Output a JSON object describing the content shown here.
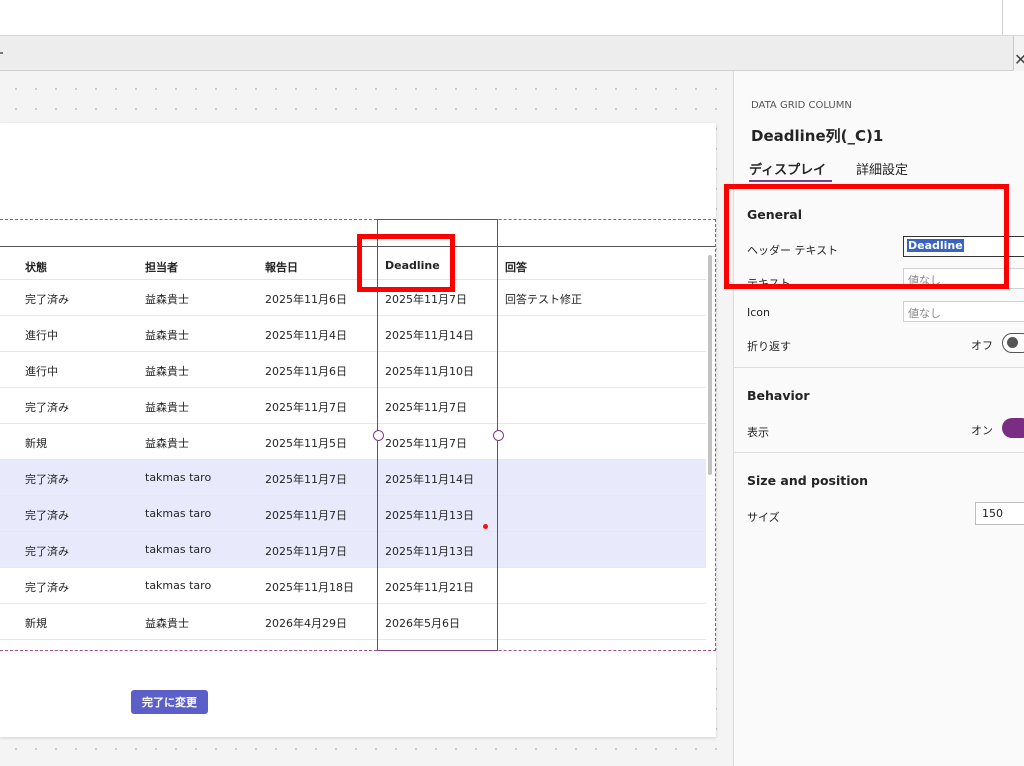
{
  "grid": {
    "headers": [
      "状態",
      "担当者",
      "報告日",
      "Deadline",
      "回答"
    ],
    "rows": [
      {
        "status": "完了済み",
        "owner": "益森貴士",
        "reported": "2025年11月6日",
        "deadline": "2025年11月7日",
        "answer": "回答テスト修正",
        "selected": false
      },
      {
        "status": "進行中",
        "owner": "益森貴士",
        "reported": "2025年11月4日",
        "deadline": "2025年11月14日",
        "answer": "",
        "selected": false
      },
      {
        "status": "進行中",
        "owner": "益森貴士",
        "reported": "2025年11月6日",
        "deadline": "2025年11月10日",
        "answer": "",
        "selected": false
      },
      {
        "status": "完了済み",
        "owner": "益森貴士",
        "reported": "2025年11月7日",
        "deadline": "2025年11月7日",
        "answer": "",
        "selected": false
      },
      {
        "status": "新規",
        "owner": "益森貴士",
        "reported": "2025年11月5日",
        "deadline": "2025年11月7日",
        "answer": "",
        "selected": false
      },
      {
        "status": "完了済み",
        "owner": "takmas taro",
        "reported": "2025年11月7日",
        "deadline": "2025年11月14日",
        "answer": "",
        "selected": true
      },
      {
        "status": "完了済み",
        "owner": "takmas taro",
        "reported": "2025年11月7日",
        "deadline": "2025年11月13日",
        "answer": "",
        "selected": true
      },
      {
        "status": "完了済み",
        "owner": "takmas taro",
        "reported": "2025年11月7日",
        "deadline": "2025年11月13日",
        "answer": "",
        "selected": true
      },
      {
        "status": "完了済み",
        "owner": "takmas taro",
        "reported": "2025年11月18日",
        "deadline": "2025年11月21日",
        "answer": "",
        "selected": false
      },
      {
        "status": "新規",
        "owner": "益森貴士",
        "reported": "2026年4月29日",
        "deadline": "2026年5月6日",
        "answer": "",
        "selected": false
      }
    ]
  },
  "button_label": "完了に変更",
  "panel": {
    "kicker": "DATA GRID COLUMN",
    "title": "Deadline列(_C)1",
    "tabs": [
      "ディスプレイ",
      "詳細設定"
    ],
    "general": {
      "title": "General",
      "header_text_label": "ヘッダー テキスト",
      "header_text_value": "Deadline",
      "text_label": "テキスト",
      "text_placeholder": "値なし",
      "icon_label": "Icon",
      "icon_placeholder": "値なし",
      "wrap_label": "折り返す",
      "wrap_state": "オフ"
    },
    "behavior": {
      "title": "Behavior",
      "visible_label": "表示",
      "visible_state": "オン"
    },
    "size_position": {
      "title": "Size and position",
      "size_label": "サイズ",
      "size_value": "150"
    }
  },
  "colors": {
    "accent_purple": "#7b2d83",
    "button_blue": "#5b5fc7",
    "selected_row": "#e8eafb",
    "annotation_red": "#ff0000"
  }
}
